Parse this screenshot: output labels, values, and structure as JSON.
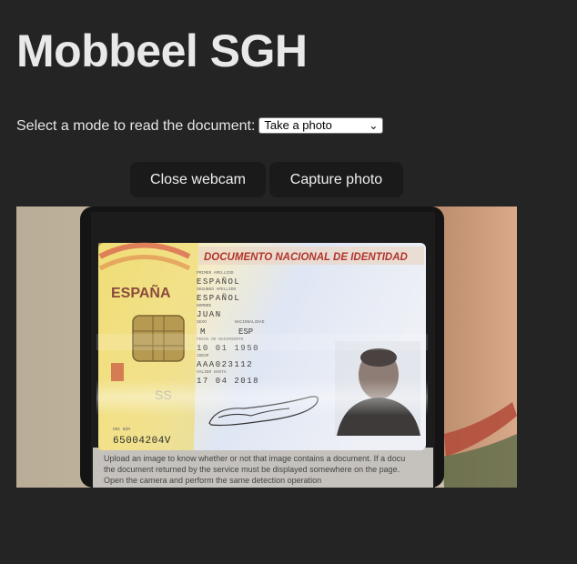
{
  "app": {
    "title": "Mobbeel SGH"
  },
  "mode": {
    "label": "Select a mode to read the document:",
    "selected": "Take a photo"
  },
  "buttons": {
    "close_webcam": "Close webcam",
    "capture_photo": "Capture photo"
  },
  "webcam": {
    "document": {
      "header": "DOCUMENTO NACIONAL DE IDENTIDAD",
      "country": "ESPAÑA",
      "surname1_label": "PRIMER APELLIDO",
      "surname1": "ESPAÑOL",
      "surname2_label": "SEGUNDO APELLIDO",
      "surname2": "ESPAÑOL",
      "name_label": "NOMBRE",
      "name": "JUAN",
      "sex_label": "SEXO",
      "sex": "M",
      "nationality_label": "NACIONALIDAD",
      "nationality": "ESP",
      "birth_label": "FECHA DE NACIMIENTO",
      "birth": "10 01 1950",
      "idesp_label": "IDESP",
      "idesp": "AAA023112",
      "valid_label": "VALIDO HASTA",
      "valid": "17 04 2018",
      "dni_label": "DNI NÚM",
      "dni": "65004204V"
    },
    "background_text": [
      "Upload an image to know whether or not that image contains a document. If a docu",
      "the document returned by the service must be displayed somewhere on the page.",
      "Open the camera and perform the same detection operation"
    ]
  },
  "colors": {
    "page_bg": "#242424",
    "button_bg": "#1a1a1a",
    "text": "#e9e9e9",
    "card_header_red": "#b2342b"
  }
}
